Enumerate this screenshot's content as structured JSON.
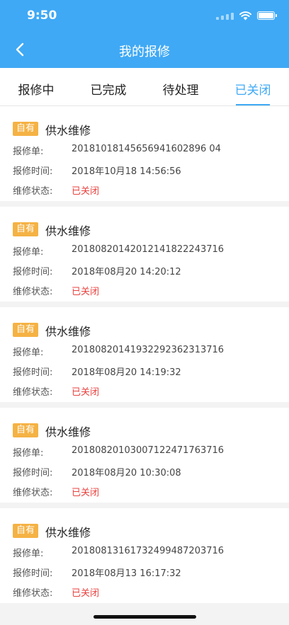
{
  "status_bar": {
    "time": "9:50"
  },
  "nav": {
    "title": "我的报修"
  },
  "tabs": [
    {
      "label": "报修中"
    },
    {
      "label": "已完成"
    },
    {
      "label": "待处理"
    },
    {
      "label": "已关闭"
    }
  ],
  "active_tab": "已关闭",
  "labels": {
    "order": "报修单:",
    "time": "报修时间:",
    "status": "维修状态:"
  },
  "records": [
    {
      "tag": "自有",
      "category": "供水维修",
      "order_no": "20181018145656941602896 04",
      "time": "2018年10月18 14:56:56",
      "status": "已关闭"
    },
    {
      "tag": "自有",
      "category": "供水维修",
      "order_no": "20180820142012141822243716",
      "time": "2018年08月20 14:20:12",
      "status": "已关闭"
    },
    {
      "tag": "自有",
      "category": "供水维修",
      "order_no": "20180820141932292362313716",
      "time": "2018年08月20 14:19:32",
      "status": "已关闭"
    },
    {
      "tag": "自有",
      "category": "供水维修",
      "order_no": "20180820103007122471763716",
      "time": "2018年08月20 10:30:08",
      "status": "已关闭"
    },
    {
      "tag": "自有",
      "category": "供水维修",
      "order_no": "20180813161732499487203716",
      "time": "2018年08月13 16:17:32",
      "status": "已关闭"
    }
  ],
  "colors": {
    "primary": "#3fa9f5",
    "tag": "#f5b244",
    "status_closed": "#e8423f"
  }
}
